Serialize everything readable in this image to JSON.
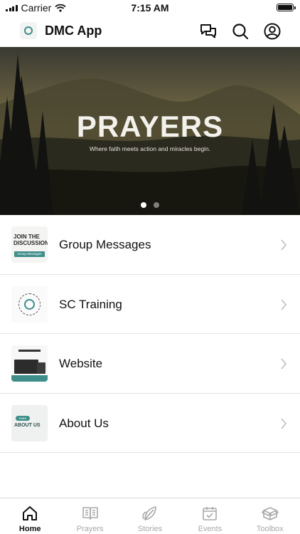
{
  "status_bar": {
    "carrier": "Carrier",
    "time": "7:15 AM"
  },
  "header": {
    "title": "DMC App",
    "icons": [
      "chat-icon",
      "search-icon",
      "profile-icon"
    ]
  },
  "hero": {
    "title": "PRAYERS",
    "subtitle": "Where faith meets action and miracles begin.",
    "slides": 2,
    "active_slide": 0
  },
  "list": {
    "items": [
      {
        "label": "Group Messages",
        "thumb_text": [
          "JOIN THE",
          "DISCUSSION"
        ],
        "thumb_badge": "Group Messages"
      },
      {
        "label": "SC Training"
      },
      {
        "label": "Website"
      },
      {
        "label": "About Us",
        "thumb_badge": "more",
        "thumb_text": "ABOUT US"
      }
    ]
  },
  "tabs": [
    {
      "label": "Home",
      "icon": "home-icon",
      "active": true
    },
    {
      "label": "Prayers",
      "icon": "book-icon",
      "active": false
    },
    {
      "label": "Stories",
      "icon": "leaf-icon",
      "active": false
    },
    {
      "label": "Events",
      "icon": "calendar-check-icon",
      "active": false
    },
    {
      "label": "Toolbox",
      "icon": "box-icon",
      "active": false
    }
  ],
  "colors": {
    "accent": "#3f8e8a",
    "tab_inactive": "#a8a8a8"
  }
}
